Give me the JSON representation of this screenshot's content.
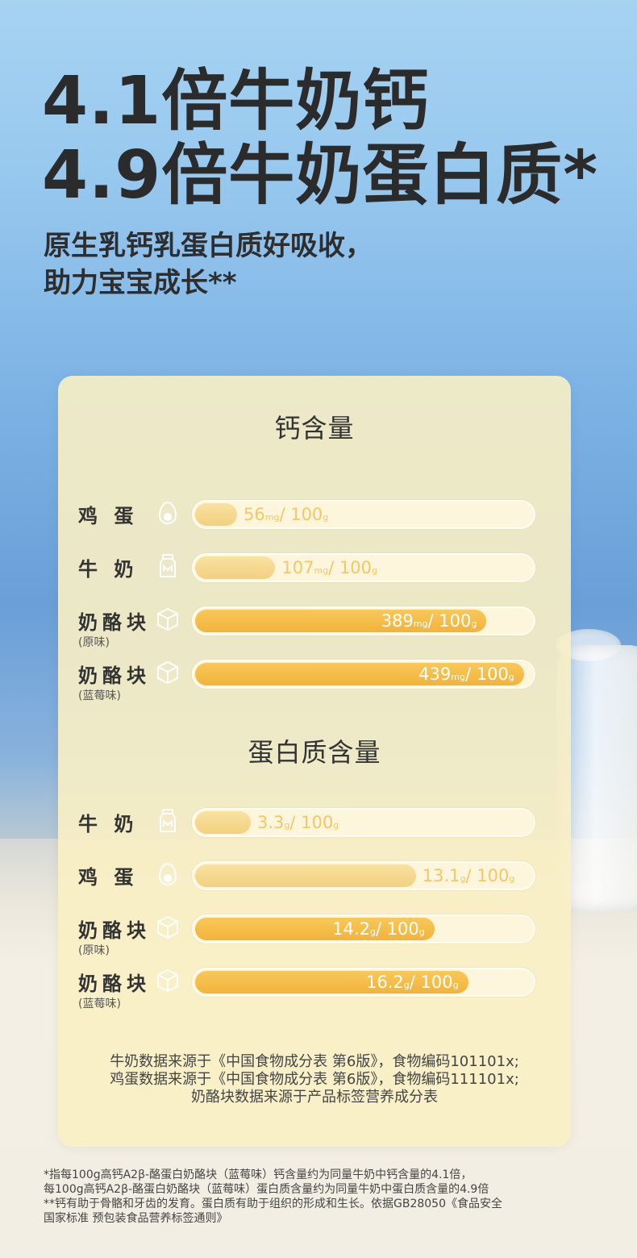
{
  "headline": {
    "line1": "4.1倍牛奶钙",
    "line2": "4.9倍牛奶蛋白质*"
  },
  "subheadline": {
    "line1": "原生乳钙乳蛋白质好吸收，",
    "line2": "助力宝宝成长**"
  },
  "colors": {
    "bar_light": "#f6d98c",
    "bar_dark": "#f4bb45",
    "value_outside": "#f2c765",
    "value_inside": "#ffffff",
    "card_bg": "#f9f0c4"
  },
  "chart_data": [
    {
      "type": "bar",
      "title": "钙含量",
      "orientation": "horizontal",
      "categories": [
        "鸡蛋",
        "牛奶",
        "奶酪块（原味）",
        "奶酪块（蓝莓味）"
      ],
      "values": [
        56,
        107,
        389,
        439
      ],
      "unit": "mg / 100g",
      "xlim": [
        0,
        450
      ],
      "rows": [
        {
          "label": "鸡 蛋",
          "sub": "",
          "icon": "egg-icon",
          "value": 56,
          "num": "56",
          "unit_small": "mg",
          "per": "/ 100",
          "per_unit": "g",
          "style": "light"
        },
        {
          "label": "牛 奶",
          "sub": "",
          "icon": "milk-bottle-icon",
          "value": 107,
          "num": "107",
          "unit_small": "mg",
          "per": "/ 100",
          "per_unit": "g",
          "style": "light"
        },
        {
          "label": "奶酪块",
          "sub": "(原味)",
          "icon": "cheese-cube-icon",
          "value": 389,
          "num": "389",
          "unit_small": "mg",
          "per": "/ 100",
          "per_unit": "g",
          "style": "dark"
        },
        {
          "label": "奶酪块",
          "sub": "(蓝莓味)",
          "icon": "cheese-cube-icon",
          "value": 439,
          "num": "439",
          "unit_small": "mg",
          "per": "/ 100",
          "per_unit": "g",
          "style": "dark"
        }
      ]
    },
    {
      "type": "bar",
      "title": "蛋白质含量",
      "orientation": "horizontal",
      "categories": [
        "牛奶",
        "鸡蛋",
        "奶酪块（原味）",
        "奶酪块（蓝莓味）"
      ],
      "values": [
        3.3,
        13.1,
        14.2,
        16.2
      ],
      "unit": "g / 100g",
      "xlim": [
        0,
        20
      ],
      "rows": [
        {
          "label": "牛 奶",
          "sub": "",
          "icon": "milk-bottle-icon",
          "value": 3.3,
          "num": "3.3",
          "unit_small": "g",
          "per": "/ 100",
          "per_unit": "g",
          "style": "light"
        },
        {
          "label": "鸡 蛋",
          "sub": "",
          "icon": "egg-icon",
          "value": 13.1,
          "num": "13.1",
          "unit_small": "g",
          "per": "/ 100",
          "per_unit": "g",
          "style": "light"
        },
        {
          "label": "奶酪块",
          "sub": "(原味)",
          "icon": "cheese-cube-icon",
          "value": 14.2,
          "num": "14.2",
          "unit_small": "g",
          "per": "/ 100",
          "per_unit": "g",
          "style": "dark"
        },
        {
          "label": "奶酪块",
          "sub": "(蓝莓味)",
          "icon": "cheese-cube-icon",
          "value": 16.2,
          "num": "16.2",
          "unit_small": "g",
          "per": "/ 100",
          "per_unit": "g",
          "style": "dark"
        }
      ]
    }
  ],
  "card_notes": [
    "牛奶数据来源于《中国食物成分表 第6版》，食物编码101101x;",
    "鸡蛋数据来源于《中国食物成分表 第6版》，食物编码111101x;",
    "奶酪块数据来源于产品标签营养成分表"
  ],
  "footnotes": [
    "*指每100g高钙A2β-酪蛋白奶酪块（蓝莓味）钙含量约为同量牛奶中钙含量的4.1倍，",
    "每100g高钙A2β-酪蛋白奶酪块（蓝莓味）蛋白质含量约为同量牛奶中蛋白质含量的4.9倍",
    "**钙有助于骨骼和牙齿的发育。蛋白质有助于组织的形成和生长。依据GB28050《食品安全",
    "国家标准 预包装食品营养标签通则》"
  ]
}
